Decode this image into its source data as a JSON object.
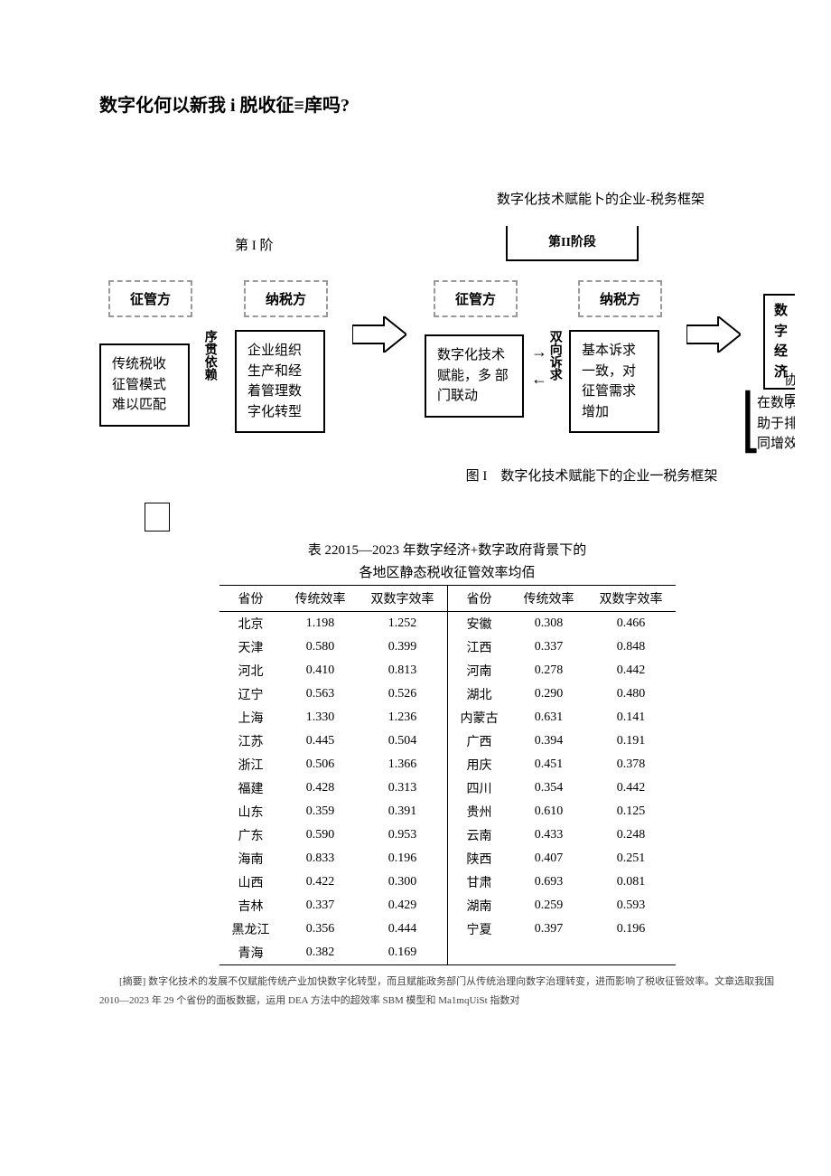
{
  "title": "数字化何以新我 i 脱收征≡庠吗?",
  "diagram": {
    "title": "数字化技术赋能卜的企业-税务框架",
    "stage1_label": "第 I 阶",
    "stage2_label": "第II阶段",
    "boxes": {
      "zgf1": "征管方",
      "nsf1": "纳税方",
      "zgf2": "征管方",
      "nsf2": "纳税方",
      "sjjj": "数字\n经济",
      "box1": "传统税收\n征管模式\n难以匹配",
      "box2": "企业组织\n生产和经\n着管理数\n字化转型",
      "box3": "数字化技术\n赋能，多\n部门联动",
      "box4": "基本诉求\n一致，对\n征管需求\n增加",
      "vert1": "序贯依赖",
      "vert2": "双向诉求",
      "side_xt": "协同",
      "side_txt": "在数字生态下,\n助于排除冗余,\n同增效"
    },
    "caption": "图 I　数字化技术赋能下的企业一税务框架"
  },
  "table": {
    "title_l1": "表 22015—2023 年数字经济+数字政府背景下的",
    "title_l2": "各地区静态税收征管效率均佰",
    "headers": [
      "省份",
      "传统效率",
      "双数字效率",
      "省份",
      "传统效率",
      "双数字效率"
    ],
    "rows": [
      [
        "北京",
        "1.198",
        "1.252",
        "安徽",
        "0.308",
        "0.466"
      ],
      [
        "天津",
        "0.580",
        "0.399",
        "江西",
        "0.337",
        "0.848"
      ],
      [
        "河北",
        "0.410",
        "0.813",
        "河南",
        "0.278",
        "0.442"
      ],
      [
        "辽宁",
        "0.563",
        "0.526",
        "湖北",
        "0.290",
        "0.480"
      ],
      [
        "上海",
        "1.330",
        "1.236",
        "内蒙古",
        "0.631",
        "0.141"
      ],
      [
        "江苏",
        "0.445",
        "0.504",
        "广西",
        "0.394",
        "0.191"
      ],
      [
        "浙江",
        "0.506",
        "1.366",
        "用庆",
        "0.451",
        "0.378"
      ],
      [
        "福建",
        "0.428",
        "0.313",
        "四川",
        "0.354",
        "0.442"
      ],
      [
        "山东",
        "0.359",
        "0.391",
        "贵州",
        "0.610",
        "0.125"
      ],
      [
        "广东",
        "0.590",
        "0.953",
        "云南",
        "0.433",
        "0.248"
      ],
      [
        "海南",
        "0.833",
        "0.196",
        "陕西",
        "0.407",
        "0.251"
      ],
      [
        "山西",
        "0.422",
        "0.300",
        "甘肃",
        "0.693",
        "0.081"
      ],
      [
        "吉林",
        "0.337",
        "0.429",
        "湖南",
        "0.259",
        "0.593"
      ],
      [
        "黑龙江",
        "0.356",
        "0.444",
        "宁夏",
        "0.397",
        "0.196"
      ],
      [
        "青海",
        "0.382",
        "0.169",
        "",
        "",
        ""
      ]
    ]
  },
  "chart_data": {
    "type": "table",
    "title": "2015—2023 年数字经济+数字政府背景下的各地区静态税收征管效率均值",
    "columns": [
      "省份",
      "传统效率",
      "双数字效率"
    ],
    "rows": [
      {
        "省份": "北京",
        "传统效率": 1.198,
        "双数字效率": 1.252
      },
      {
        "省份": "天津",
        "传统效率": 0.58,
        "双数字效率": 0.399
      },
      {
        "省份": "河北",
        "传统效率": 0.41,
        "双数字效率": 0.813
      },
      {
        "省份": "辽宁",
        "传统效率": 0.563,
        "双数字效率": 0.526
      },
      {
        "省份": "上海",
        "传统效率": 1.33,
        "双数字效率": 1.236
      },
      {
        "省份": "江苏",
        "传统效率": 0.445,
        "双数字效率": 0.504
      },
      {
        "省份": "浙江",
        "传统效率": 0.506,
        "双数字效率": 1.366
      },
      {
        "省份": "福建",
        "传统效率": 0.428,
        "双数字效率": 0.313
      },
      {
        "省份": "山东",
        "传统效率": 0.359,
        "双数字效率": 0.391
      },
      {
        "省份": "广东",
        "传统效率": 0.59,
        "双数字效率": 0.953
      },
      {
        "省份": "海南",
        "传统效率": 0.833,
        "双数字效率": 0.196
      },
      {
        "省份": "山西",
        "传统效率": 0.422,
        "双数字效率": 0.3
      },
      {
        "省份": "吉林",
        "传统效率": 0.337,
        "双数字效率": 0.429
      },
      {
        "省份": "黑龙江",
        "传统效率": 0.356,
        "双数字效率": 0.444
      },
      {
        "省份": "青海",
        "传统效率": 0.382,
        "双数字效率": 0.169
      },
      {
        "省份": "安徽",
        "传统效率": 0.308,
        "双数字效率": 0.466
      },
      {
        "省份": "江西",
        "传统效率": 0.337,
        "双数字效率": 0.848
      },
      {
        "省份": "河南",
        "传统效率": 0.278,
        "双数字效率": 0.442
      },
      {
        "省份": "湖北",
        "传统效率": 0.29,
        "双数字效率": 0.48
      },
      {
        "省份": "内蒙古",
        "传统效率": 0.631,
        "双数字效率": 0.141
      },
      {
        "省份": "广西",
        "传统效率": 0.394,
        "双数字效率": 0.191
      },
      {
        "省份": "用庆",
        "传统效率": 0.451,
        "双数字效率": 0.378
      },
      {
        "省份": "四川",
        "传统效率": 0.354,
        "双数字效率": 0.442
      },
      {
        "省份": "贵州",
        "传统效率": 0.61,
        "双数字效率": 0.125
      },
      {
        "省份": "云南",
        "传统效率": 0.433,
        "双数字效率": 0.248
      },
      {
        "省份": "陕西",
        "传统效率": 0.407,
        "双数字效率": 0.251
      },
      {
        "省份": "甘肃",
        "传统效率": 0.693,
        "双数字效率": 0.081
      },
      {
        "省份": "湖南",
        "传统效率": 0.259,
        "双数字效率": 0.593
      },
      {
        "省份": "宁夏",
        "传统效率": 0.397,
        "双数字效率": 0.196
      }
    ]
  },
  "abstract": {
    "label": "[摘要]",
    "text": "数字化技术的发展不仅赋能传统产业加快数字化转型，而且赋能政务部门从传统治理向数字治理转变，进而影响了税收征管效率。文章选取我国 2010—2023 年 29 个省份的面板数据，运用 DEA 方法中的超效率 SBM 模型和 Ma1mqUiSt 指数对"
  }
}
